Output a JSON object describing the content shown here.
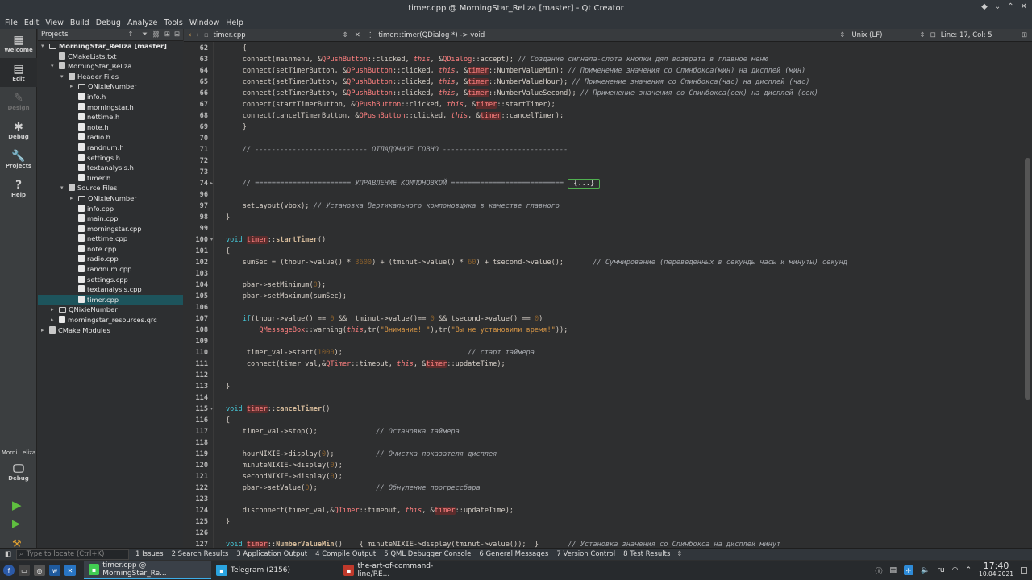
{
  "window": {
    "title": "timer.cpp @ MorningStar_Reliza [master] - Qt Creator"
  },
  "menu": [
    "File",
    "Edit",
    "View",
    "Build",
    "Debug",
    "Analyze",
    "Tools",
    "Window",
    "Help"
  ],
  "modes": [
    {
      "icon": "grid-icon",
      "glyph": "▦",
      "label": "Welcome"
    },
    {
      "icon": "edit-icon",
      "glyph": "▤",
      "label": "Edit"
    },
    {
      "icon": "design-icon",
      "glyph": "✎",
      "label": "Design"
    },
    {
      "icon": "debug-icon",
      "glyph": "✱",
      "label": "Debug"
    },
    {
      "icon": "projects-icon",
      "glyph": "🔧",
      "label": "Projects"
    },
    {
      "icon": "help-icon",
      "glyph": "?",
      "label": "Help"
    }
  ],
  "kit": {
    "name": "Morni...eliza",
    "label": "Debug"
  },
  "projects": {
    "header": "Projects",
    "tree": [
      {
        "label": "MorningStar_Reliza [master]",
        "depth": 0,
        "arrow": "▾",
        "icon": "folder",
        "bold": true
      },
      {
        "label": "CMakeLists.txt",
        "depth": 1,
        "arrow": "",
        "icon": "cm"
      },
      {
        "label": "MorningStar_Reliza",
        "depth": 1,
        "arrow": "▾",
        "icon": "cm"
      },
      {
        "label": "Header Files",
        "depth": 2,
        "arrow": "▾",
        "icon": "cm"
      },
      {
        "label": "QNixieNumber",
        "depth": 3,
        "arrow": "▸",
        "icon": "folder"
      },
      {
        "label": "info.h",
        "depth": 3,
        "arrow": "",
        "icon": "file"
      },
      {
        "label": "morningstar.h",
        "depth": 3,
        "arrow": "",
        "icon": "file"
      },
      {
        "label": "nettime.h",
        "depth": 3,
        "arrow": "",
        "icon": "file"
      },
      {
        "label": "note.h",
        "depth": 3,
        "arrow": "",
        "icon": "file"
      },
      {
        "label": "radio.h",
        "depth": 3,
        "arrow": "",
        "icon": "file"
      },
      {
        "label": "randnum.h",
        "depth": 3,
        "arrow": "",
        "icon": "file"
      },
      {
        "label": "settings.h",
        "depth": 3,
        "arrow": "",
        "icon": "file"
      },
      {
        "label": "textanalysis.h",
        "depth": 3,
        "arrow": "",
        "icon": "file"
      },
      {
        "label": "timer.h",
        "depth": 3,
        "arrow": "",
        "icon": "file"
      },
      {
        "label": "Source Files",
        "depth": 2,
        "arrow": "▾",
        "icon": "cm"
      },
      {
        "label": "QNixieNumber",
        "depth": 3,
        "arrow": "▸",
        "icon": "folder"
      },
      {
        "label": "info.cpp",
        "depth": 3,
        "arrow": "",
        "icon": "file"
      },
      {
        "label": "main.cpp",
        "depth": 3,
        "arrow": "",
        "icon": "file"
      },
      {
        "label": "morningstar.cpp",
        "depth": 3,
        "arrow": "",
        "icon": "file"
      },
      {
        "label": "nettime.cpp",
        "depth": 3,
        "arrow": "",
        "icon": "file"
      },
      {
        "label": "note.cpp",
        "depth": 3,
        "arrow": "",
        "icon": "file"
      },
      {
        "label": "radio.cpp",
        "depth": 3,
        "arrow": "",
        "icon": "file"
      },
      {
        "label": "randnum.cpp",
        "depth": 3,
        "arrow": "",
        "icon": "file"
      },
      {
        "label": "settings.cpp",
        "depth": 3,
        "arrow": "",
        "icon": "file"
      },
      {
        "label": "textanalysis.cpp",
        "depth": 3,
        "arrow": "",
        "icon": "file"
      },
      {
        "label": "timer.cpp",
        "depth": 3,
        "arrow": "",
        "icon": "file",
        "selected": true
      },
      {
        "label": "QNixieNumber",
        "depth": 1,
        "arrow": "▸",
        "icon": "folder"
      },
      {
        "label": "morningstar_resources.qrc",
        "depth": 1,
        "arrow": "▸",
        "icon": "file"
      },
      {
        "label": "CMake Modules",
        "depth": 0,
        "arrow": "▸",
        "icon": "cm"
      }
    ]
  },
  "editor_toolbar": {
    "file": "timer.cpp",
    "symbol": "timer::timer(QDialog *) -> void",
    "line_endings": "Unix (LF)",
    "position": "Line: 17, Col: 5"
  },
  "code_lines": [
    {
      "n": "62",
      "html": "    {"
    },
    {
      "n": "63",
      "html": "    connect(mainmenu, &<span class=\"cls\">QPushButton</span>::clicked, <span class=\"it\">this</span>, &<span class=\"cls\">QDialog</span>::accept); <span class=\"cm\">// Создание сигнала-слота кнопки дял возврата в главное меню</span>"
    },
    {
      "n": "64",
      "html": "    connect(setTimerButton, &<span class=\"cls\">QPushButton</span>::clicked, <span class=\"it\">this</span>, &<span class=\"hl\">timer</span>::NumberValueMin); <span class=\"cm\">// Применение значения со Спинбокса(мин) на дисплей (мин)</span>"
    },
    {
      "n": "65",
      "html": "    connect(setTimerButton, &<span class=\"cls\">QPushButton</span>::clicked, <span class=\"it\">this</span>, &<span class=\"hl\">timer</span>::NumberValueHour); <span class=\"cm\">// Применение значения со Спинбокса(час) на дисплей (час)</span>"
    },
    {
      "n": "66",
      "html": "    connect(setTimerButton, &<span class=\"cls\">QPushButton</span>::clicked, <span class=\"it\">this</span>, &<span class=\"hl\">timer</span>::NumberValueSecond); <span class=\"cm\">// Применение значения со Спинбокса(сек) на дисплей (сек)</span>"
    },
    {
      "n": "67",
      "html": "    connect(startTimerButton, &<span class=\"cls\">QPushButton</span>::clicked, <span class=\"it\">this</span>, &<span class=\"hl\">timer</span>::startTimer);"
    },
    {
      "n": "68",
      "html": "    connect(cancelTimerButton, &<span class=\"cls\">QPushButton</span>::clicked, <span class=\"it\">this</span>, &<span class=\"hl\">timer</span>::cancelTimer);"
    },
    {
      "n": "69",
      "html": "    }"
    },
    {
      "n": "70",
      "html": ""
    },
    {
      "n": "71",
      "html": "    <span class=\"cm\">// --------------------------- ОТЛАДОЧНОЕ ГОВНО ------------------------------</span>"
    },
    {
      "n": "72",
      "html": ""
    },
    {
      "n": "73",
      "html": ""
    },
    {
      "n": "74",
      "html": "    <span class=\"cm\">// ======================= УПРАВЛЕНИЕ КОМПОНОВКОЙ ===========================</span> <span class=\"foldbox\">{...}</span>"
    },
    {
      "n": "96",
      "html": ""
    },
    {
      "n": "97",
      "html": "    setLayout(vbox); <span class=\"cm\">// Установка Вертикального компоновщика в качестве главного</span>"
    },
    {
      "n": "98",
      "html": "}"
    },
    {
      "n": "99",
      "html": ""
    },
    {
      "n": "100",
      "html": "<span class=\"k\">void</span> <span class=\"hl\">timer</span>::<span class=\"fn\">startTimer</span>()"
    },
    {
      "n": "101",
      "html": "{"
    },
    {
      "n": "102",
      "html": "    sumSec = (thour->value() * <span class=\"num\">3600</span>) + (tminut->value() * <span class=\"num\">60</span>) + tsecond->value();       <span class=\"cm\">// Суммирование (переведенных в секунды часы и минуты) секунд</span>"
    },
    {
      "n": "103",
      "html": ""
    },
    {
      "n": "104",
      "html": "    pbar->setMinimum(<span class=\"num\">0</span>);"
    },
    {
      "n": "105",
      "html": "    pbar->setMaximum(sumSec);"
    },
    {
      "n": "106",
      "html": ""
    },
    {
      "n": "107",
      "html": "    <span class=\"k\">if</span>(thour->value() == <span class=\"num\">0</span> &&  tminut->value()== <span class=\"num\">0</span> && tsecond->value() == <span class=\"num\">0</span>)"
    },
    {
      "n": "108",
      "html": "        <span class=\"cls\">QMessageBox</span>::warning(<span class=\"it\">this</span>,tr(<span class=\"str\">\"Внимание! \"</span>),tr(<span class=\"str\">\"Вы не установили время!\"</span>));"
    },
    {
      "n": "109",
      "html": ""
    },
    {
      "n": "110",
      "html": "     timer_val->start(<span class=\"num\">1000</span>);                              <span class=\"cm\">// старт таймера</span>"
    },
    {
      "n": "111",
      "html": "     connect(timer_val,&<span class=\"cls\">QTimer</span>::timeout, <span class=\"it\">this</span>, &<span class=\"hl\">timer</span>::updateTime);"
    },
    {
      "n": "112",
      "html": ""
    },
    {
      "n": "113",
      "html": "}"
    },
    {
      "n": "114",
      "html": ""
    },
    {
      "n": "115",
      "html": "<span class=\"k\">void</span> <span class=\"hl\">timer</span>::<span class=\"fn\">cancelTimer</span>()"
    },
    {
      "n": "116",
      "html": "{"
    },
    {
      "n": "117",
      "html": "    timer_val->stop();              <span class=\"cm\">// Остановка таймера</span>"
    },
    {
      "n": "118",
      "html": ""
    },
    {
      "n": "119",
      "html": "    hourNIXIE->display(<span class=\"num\">0</span>);          <span class=\"cm\">// Очистка показателя дисплея</span>"
    },
    {
      "n": "120",
      "html": "    minuteNIXIE->display(<span class=\"num\">0</span>);"
    },
    {
      "n": "121",
      "html": "    secondNIXIE->display(<span class=\"num\">0</span>);"
    },
    {
      "n": "122",
      "html": "    pbar->setValue(<span class=\"num\">0</span>);              <span class=\"cm\">// Обнуление прогрессбара</span>"
    },
    {
      "n": "123",
      "html": ""
    },
    {
      "n": "124",
      "html": "    disconnect(timer_val,&<span class=\"cls\">QTimer</span>::timeout, <span class=\"it\">this</span>, &<span class=\"hl\">timer</span>::updateTime);"
    },
    {
      "n": "125",
      "html": "}"
    },
    {
      "n": "126",
      "html": ""
    },
    {
      "n": "127",
      "html": "<span class=\"k\">void</span> <span class=\"hl\">timer</span>::<span class=\"fn\">NumberValueMin</span>()    { minuteNIXIE->display(tminut->value());  }       <span class=\"cm\">// Установка значения со Спинбокса на дисплей минут</span>"
    }
  ],
  "fold_lines": [
    "74",
    "100",
    "115"
  ],
  "output_panes": {
    "locator_placeholder": "Type to locate (Ctrl+K)",
    "tabs": [
      "1 Issues",
      "2 Search Results",
      "3 Application Output",
      "4 Compile Output",
      "5 QML Debugger Console",
      "6 General Messages",
      "7 Version Control",
      "8 Test Results"
    ]
  },
  "taskbar": {
    "tasks": [
      {
        "label": "timer.cpp @ MorningStar_Re...",
        "icon": "qt-creator-icon",
        "color": "#41cd52",
        "active": true
      },
      {
        "label": "Telegram (2156)",
        "icon": "telegram-icon",
        "color": "#2aa3df",
        "active": false
      },
      {
        "label": "the-art-of-command-line/RE...",
        "icon": "browser-icon",
        "color": "#c0392b",
        "active": false
      }
    ],
    "lang": "ru",
    "time": "17:40",
    "date": "10.04.2021"
  }
}
